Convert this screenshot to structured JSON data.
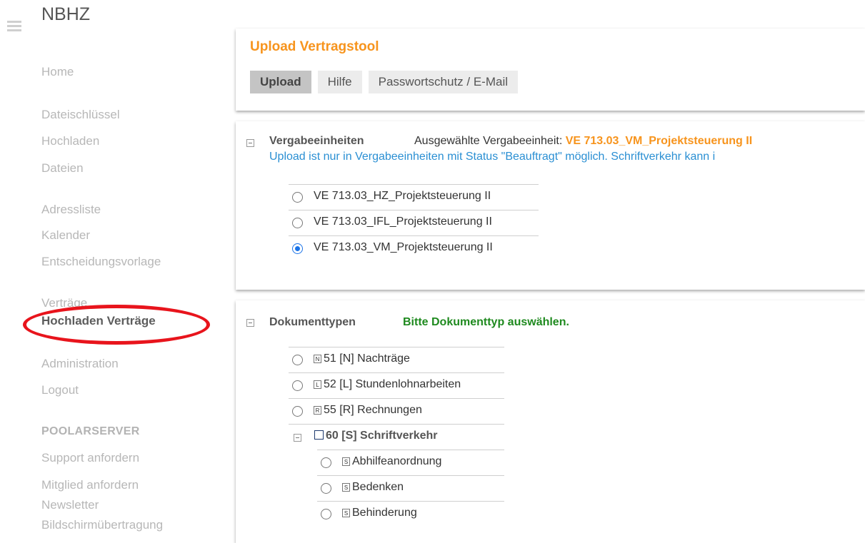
{
  "header": {
    "brand": "NBHZ",
    "menu_icon": "hamburger-icon"
  },
  "sidebar": {
    "home": "Home",
    "dateischluessel": "Dateischlüssel",
    "hochladen": "Hochladen",
    "dateien": "Dateien",
    "adressliste": "Adressliste",
    "kalender": "Kalender",
    "entscheidungsvorlage": "Entscheidungsvorlage",
    "vertraege": "Verträge",
    "hochladen_vertraege": "Hochladen Verträge",
    "administration": "Administration",
    "logout": "Logout",
    "section_poolarserver": "POOLARSERVER",
    "support": "Support anfordern",
    "mitglied": "Mitglied anfordern",
    "newsletter": "Newsletter",
    "bildschirm": "Bildschirmübertragung",
    "highlight_color": "#e8141c"
  },
  "upload_panel": {
    "title": "Upload Vertragstool",
    "tabs": [
      "Upload",
      "Hilfe",
      "Passwortschutz / E-Mail"
    ],
    "selected_tab": "Upload"
  },
  "vergabe": {
    "label": "Vergabeeinheiten",
    "selected_prefix": "Ausgewählte Vergabeeinheit: ",
    "selected_value": "VE 713.03_VM_Projektsteuerung II",
    "note": "Upload ist nur in Vergabeeinheiten mit Status \"Beauftragt\" möglich. Schriftverkehr kann i",
    "options": [
      "VE 713.03_HZ_Projektsteuerung II",
      "VE 713.03_IFL_Projektsteuerung II",
      "VE 713.03_VM_Projektsteuerung II"
    ],
    "checked_index": 2
  },
  "dokumenttypen": {
    "label": "Dokumenttypen",
    "prompt": "Bitte Dokumenttyp auswählen.",
    "options": [
      {
        "icon_letter": "N",
        "text": "51 [N] Nachträge"
      },
      {
        "icon_letter": "L",
        "text": "52 [L] Stundenlohnarbeiten"
      },
      {
        "icon_letter": "R",
        "text": "55 [R] Rechnungen"
      }
    ],
    "group": {
      "text": "60 [S] Schriftverkehr",
      "children": [
        {
          "icon_letter": "S",
          "text": "Abhilfeanordnung"
        },
        {
          "icon_letter": "S",
          "text": "Bedenken"
        },
        {
          "icon_letter": "S",
          "text": "Behinderung"
        }
      ]
    }
  },
  "colors": {
    "accent_orange": "#f7941d",
    "note_blue": "#2a8fd3",
    "prompt_green": "#1f8a1f",
    "radio_blue": "#1a73e8"
  }
}
